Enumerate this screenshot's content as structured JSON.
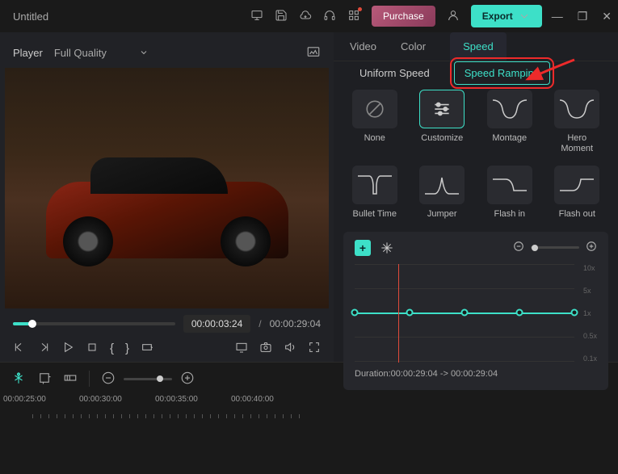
{
  "title": "Untitled",
  "titlebar": {
    "purchase_label": "Purchase",
    "export_label": "Export"
  },
  "player": {
    "label": "Player",
    "quality": "Full Quality",
    "time_current": "00:00:03:24",
    "time_separator": "/",
    "time_total": "00:00:29:04"
  },
  "right_tabs": {
    "video": "Video",
    "color": "Color",
    "speed": "Speed"
  },
  "speed_sub": {
    "uniform": "Uniform Speed",
    "ramping": "Speed Ramping"
  },
  "presets": [
    {
      "key": "none",
      "label": "None"
    },
    {
      "key": "customize",
      "label": "Customize"
    },
    {
      "key": "montage",
      "label": "Montage"
    },
    {
      "key": "hero",
      "label": "Hero Moment"
    },
    {
      "key": "bullet",
      "label": "Bullet Time"
    },
    {
      "key": "jumper",
      "label": "Jumper"
    },
    {
      "key": "flashin",
      "label": "Flash in"
    },
    {
      "key": "flashout",
      "label": "Flash out"
    }
  ],
  "graph_labels": {
    "l10": "10x",
    "l5": "5x",
    "l1": "1x",
    "l05": "0.5x",
    "l01": "0.1x"
  },
  "duration_label": "Duration:",
  "duration_from": "00:00:29:04",
  "duration_arrow": "->",
  "duration_to": "00:00:29:04",
  "timeline_ticks": [
    "00:00:25:00",
    "00:00:30:00",
    "00:00:35:00",
    "00:00:40:00"
  ]
}
